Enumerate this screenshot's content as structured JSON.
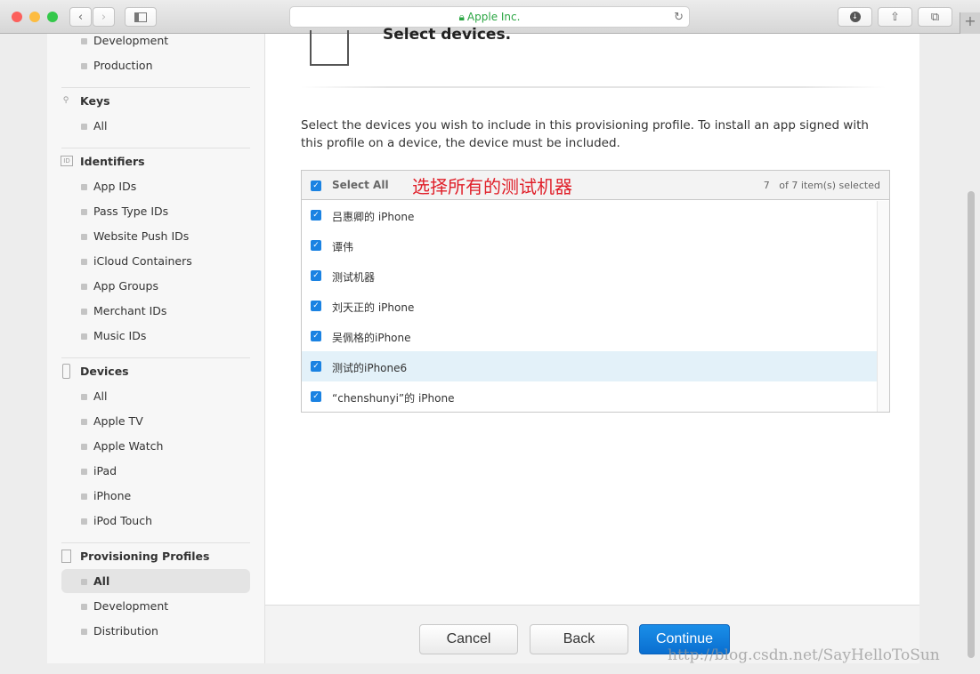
{
  "browser": {
    "url_label": "Apple Inc.",
    "lock_icon": "lock-icon"
  },
  "sidebar": {
    "certificates_items": [
      "Development",
      "Production"
    ],
    "keys": {
      "title": "Keys",
      "items": [
        "All"
      ]
    },
    "identifiers": {
      "title": "Identifiers",
      "icon_text": "ID",
      "items": [
        "App IDs",
        "Pass Type IDs",
        "Website Push IDs",
        "iCloud Containers",
        "App Groups",
        "Merchant IDs",
        "Music IDs"
      ]
    },
    "devices": {
      "title": "Devices",
      "items": [
        "All",
        "Apple TV",
        "Apple Watch",
        "iPad",
        "iPhone",
        "iPod Touch"
      ]
    },
    "profiles": {
      "title": "Provisioning Profiles",
      "items": [
        "All",
        "Development",
        "Distribution"
      ],
      "selected": "All"
    }
  },
  "main": {
    "title": "Select devices.",
    "description": "Select the devices you wish to include in this provisioning profile. To install an app signed with this profile on a device, the device must be included.",
    "table": {
      "select_all": "Select All",
      "annotation": "选择所有的测试机器",
      "count": "7",
      "count_suffix": "of 7 item(s) selected",
      "devices": [
        "吕惠卿的 iPhone",
        "谭伟",
        "测试机器",
        "刘天正的 iPhone",
        "吴佩格的iPhone",
        "测试的iPhone6",
        "“chenshunyi”的 iPhone"
      ],
      "highlighted_index": 5
    }
  },
  "footer": {
    "cancel": "Cancel",
    "back": "Back",
    "continue": "Continue"
  },
  "watermark": "http://blog.csdn.net/SayHelloToSun",
  "colors": {
    "accent": "#1a82e2",
    "annotation": "#e0202a",
    "highlight_row": "#e3f1f9"
  }
}
